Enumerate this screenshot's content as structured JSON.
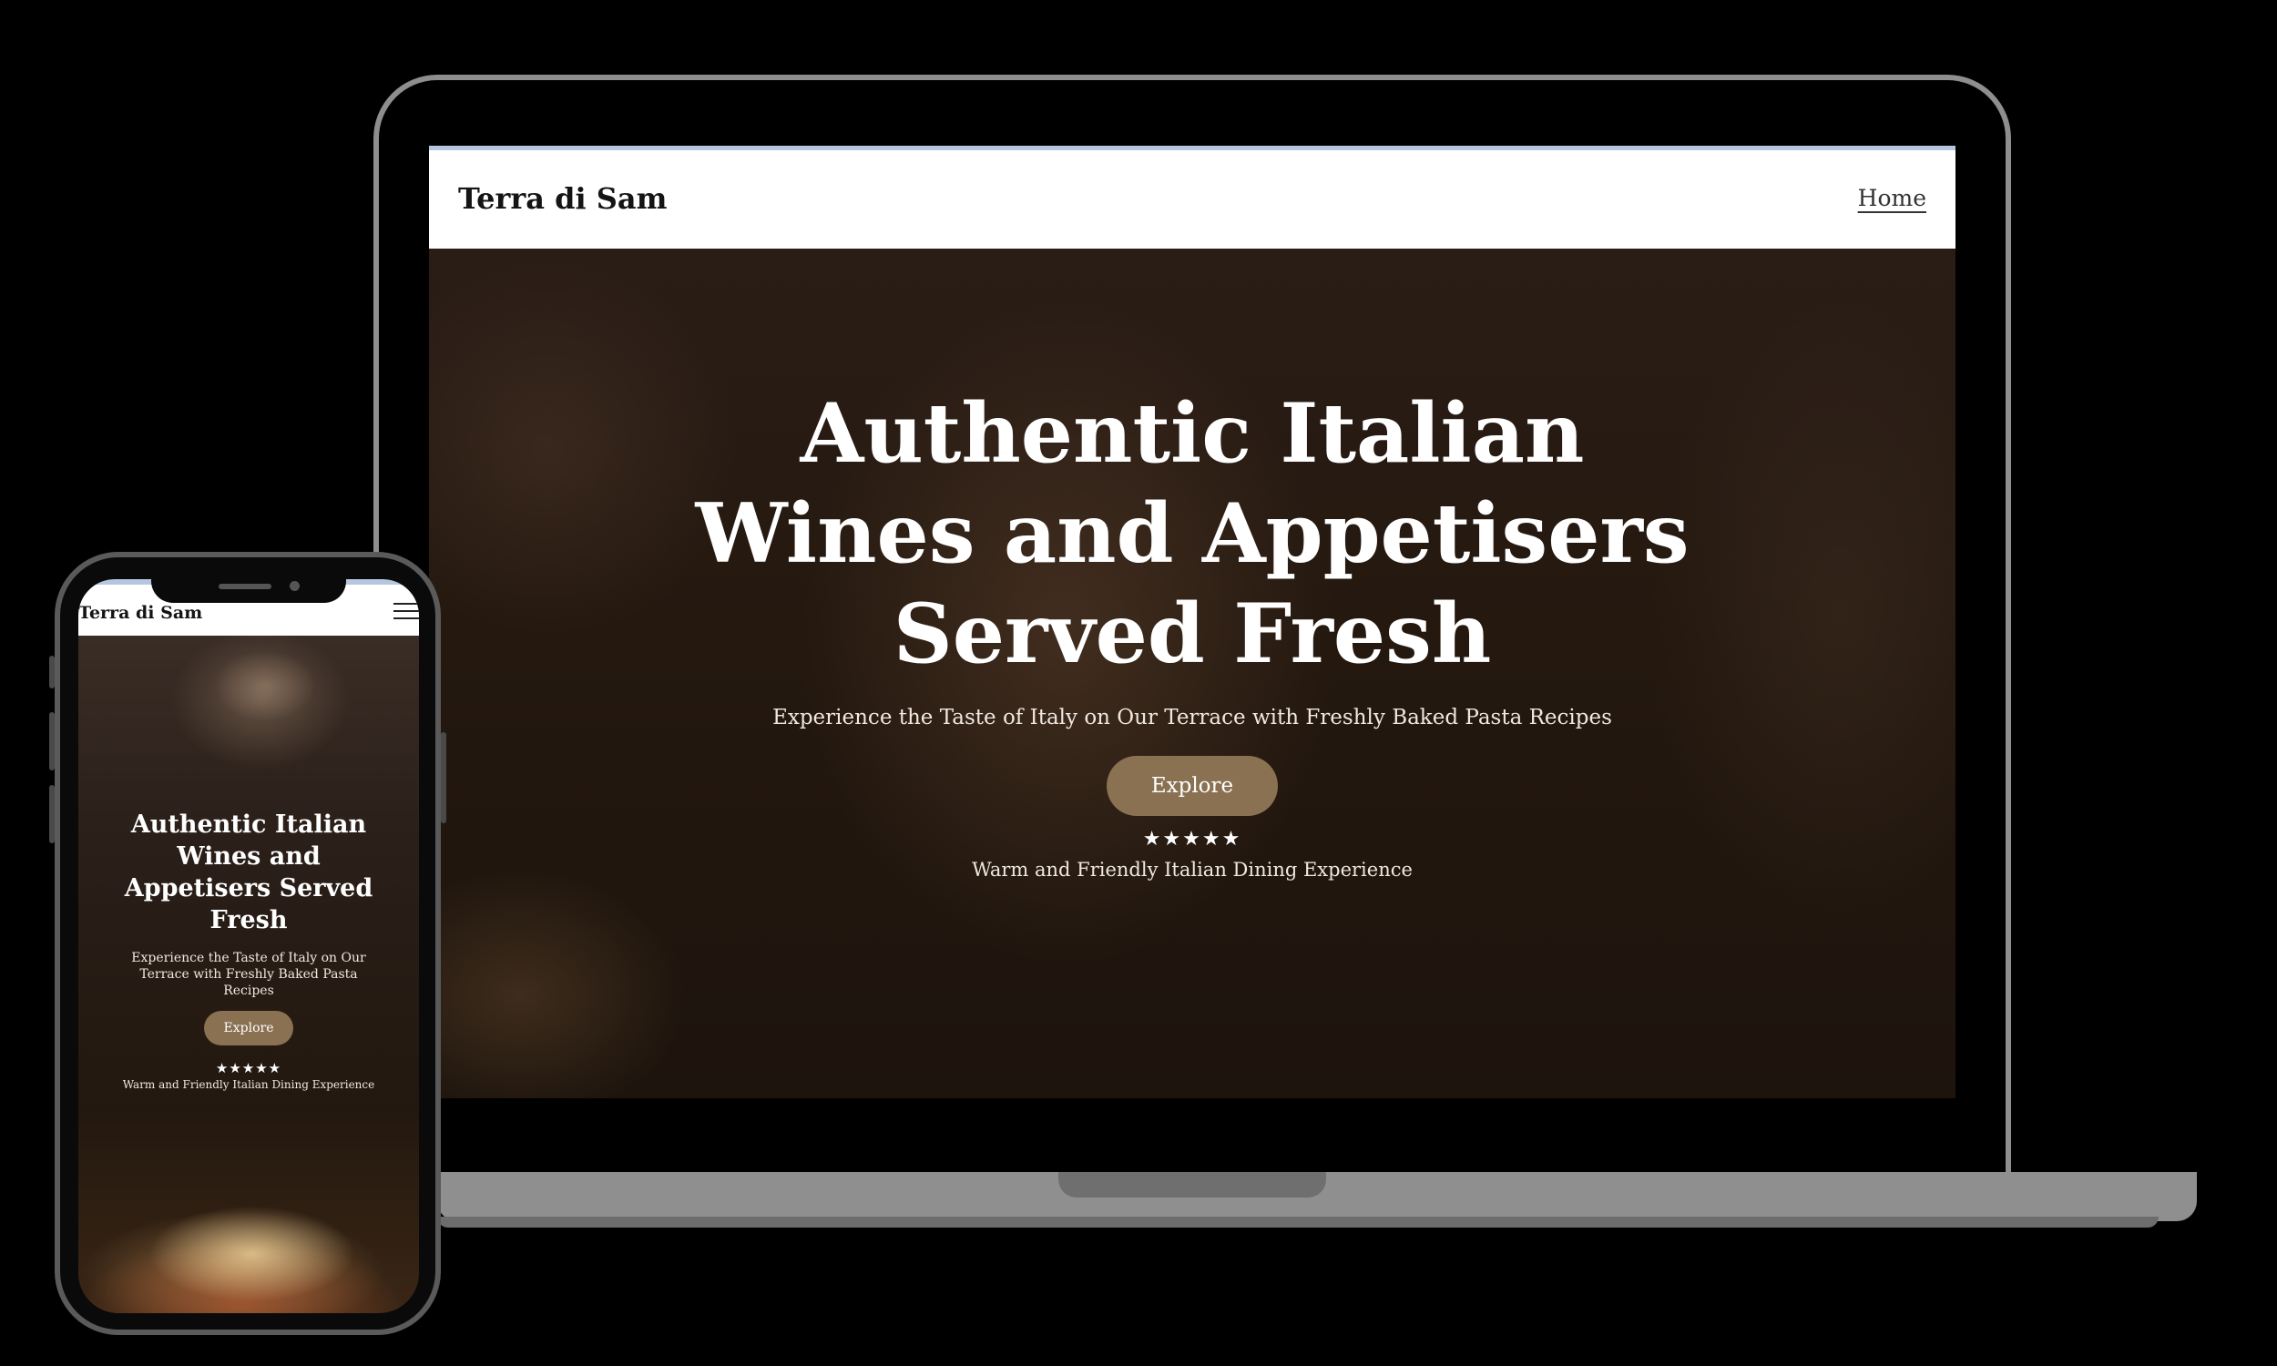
{
  "site": {
    "brand": "Terra di Sam",
    "nav": {
      "home": "Home"
    },
    "hero": {
      "title_lines_desktop": [
        "Authentic Italian",
        "Wines and Appetisers",
        "Served Fresh"
      ],
      "title_lines_mobile": [
        "Authentic Italian",
        "Wines and",
        "Appetisers Served",
        "Fresh"
      ],
      "subtitle": "Experience the Taste of Italy on Our Terrace with Freshly Baked Pasta Recipes",
      "subtitle_mobile_lines": [
        "Experience the Taste of Italy on Our",
        "Terrace with Freshly Baked Pasta Recipes"
      ],
      "button_label": "Explore",
      "stars": "★★★★★",
      "rating": 5,
      "tagline": "Warm and Friendly Italian Dining Experience"
    }
  },
  "colors": {
    "button": "#8a7152",
    "nav_background": "#ffffff",
    "top_accent": "#b7c6e0",
    "device_frame": "#8e8e8e"
  },
  "icons": {
    "menu": "hamburger-menu-icon"
  }
}
